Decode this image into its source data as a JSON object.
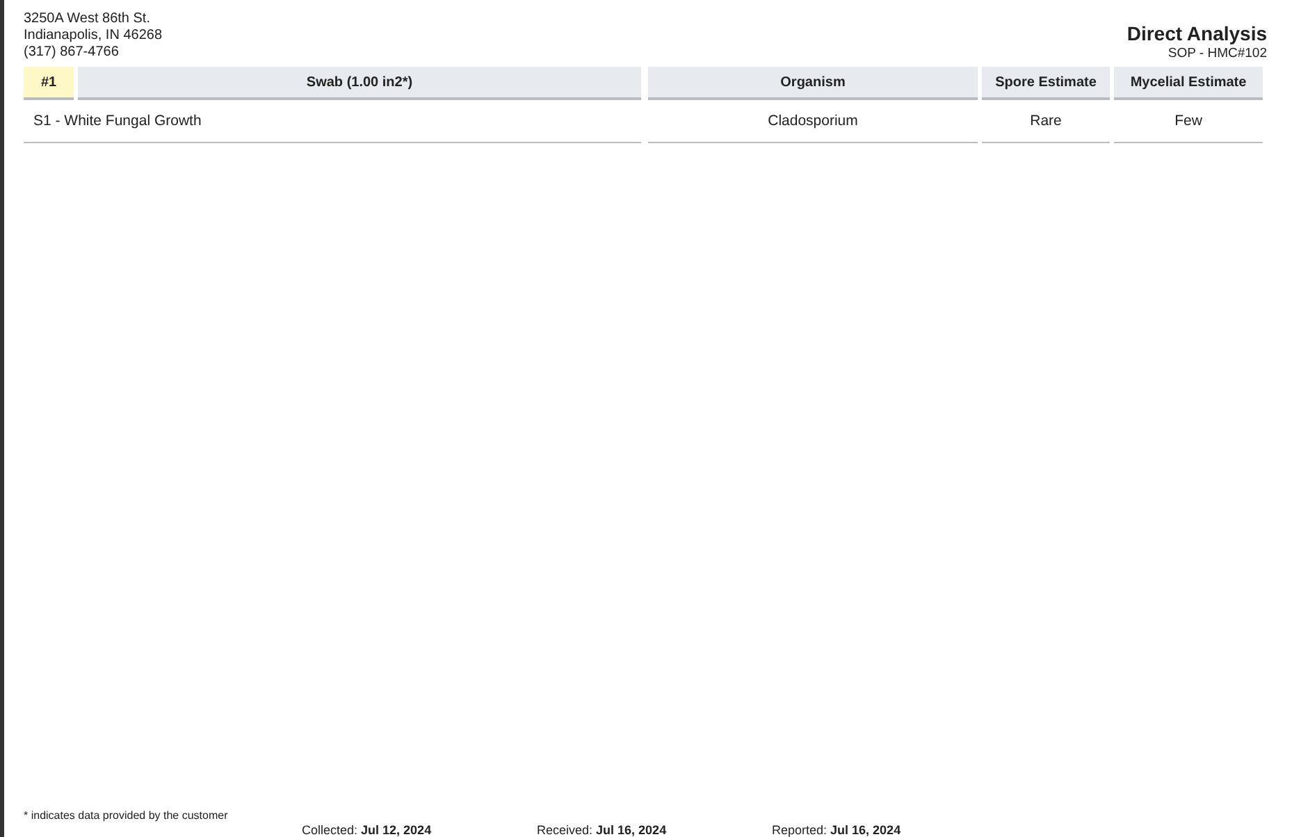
{
  "lab": {
    "address_lines": [
      "3250A West 86th St.",
      "Indianapolis, IN 46268",
      "(317) 867-4766"
    ]
  },
  "report": {
    "title": "Direct Analysis",
    "subtitle": "SOP - HMC#102"
  },
  "table": {
    "columns": [
      "#1",
      "Swab (1.00 in2*)",
      "Organism",
      "Spore Estimate",
      "Mycelial Estimate"
    ],
    "rows": [
      {
        "sample": "S1 - White Fungal Growth",
        "organism": "Cladosporium",
        "spore_estimate": "Rare",
        "mycelial_estimate": "Few"
      }
    ]
  },
  "footer": {
    "note": "* indicates data provided by the customer",
    "dates": [
      {
        "label": "Collected:",
        "value": "Jul 12, 2024"
      },
      {
        "label": "Received:",
        "value": "Jul 16, 2024"
      },
      {
        "label": "Reported:",
        "value": "Jul 16, 2024"
      }
    ]
  }
}
